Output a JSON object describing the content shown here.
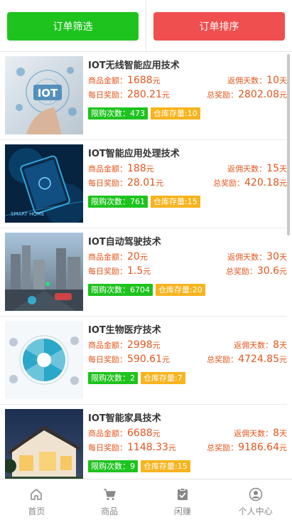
{
  "toolbar": {
    "filter_label": "订单筛选",
    "sort_label": "订单排序"
  },
  "labels": {
    "amount": "商品金额：",
    "days": "返佣天数：",
    "daily": "每日奖励：",
    "total": "总奖励：",
    "limit": "限购次数：",
    "stock": "仓库存量:"
  },
  "products": [
    {
      "title": "IOT无线智能应用技术",
      "amount": "1688",
      "days": "10",
      "daily": "280.21",
      "total": "2802.08",
      "limit": "473",
      "stock": "10",
      "image": "iot-hand-image"
    },
    {
      "title": "IOT智能应用处理技术",
      "amount": "188",
      "days": "15",
      "daily": "28.01",
      "total": "420.18",
      "limit": "761",
      "stock": "15",
      "image": "smart-home-phone-image"
    },
    {
      "title": "IOT自动驾驶技术",
      "amount": "20",
      "days": "30",
      "daily": "1.5",
      "total": "30.6",
      "limit": "6704",
      "stock": "20",
      "image": "autonomous-car-city-image"
    },
    {
      "title": "IOT生物医疗技术",
      "amount": "2998",
      "days": "8",
      "daily": "590.61",
      "total": "4724.85",
      "limit": "2",
      "stock": "7",
      "image": "medical-iot-diagram-image"
    },
    {
      "title": "IOT智能家具技术",
      "amount": "6688",
      "days": "8",
      "daily": "1148.33",
      "total": "9186.64",
      "limit": "9",
      "stock": "15",
      "image": "smart-house-image"
    }
  ],
  "unit": "元",
  "day_unit": "天",
  "tabbar": [
    {
      "label": "首页",
      "icon": "home-icon"
    },
    {
      "label": "商品",
      "icon": "cart-icon"
    },
    {
      "label": "闲赚",
      "icon": "clipboard-check-icon"
    },
    {
      "label": "个人中心",
      "icon": "user-icon"
    }
  ],
  "colors": {
    "green": "#1ec31e",
    "red": "#ef4f4f",
    "orange": "#f7b41e",
    "price": "#e2561e"
  }
}
